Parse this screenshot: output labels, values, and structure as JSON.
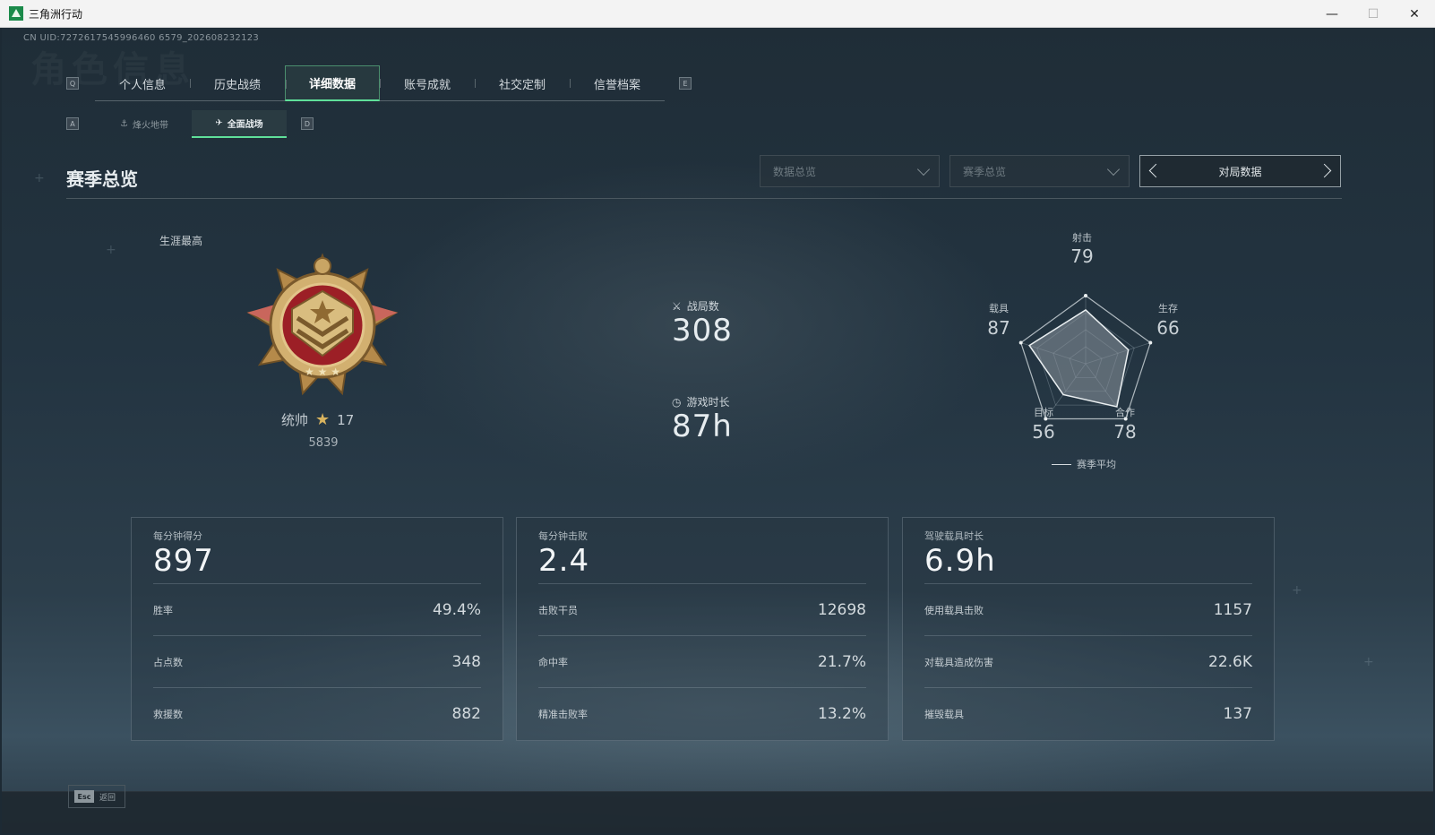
{
  "window": {
    "title": "三角洲行动",
    "minimize": "—",
    "maximize": "☐",
    "close": "✕"
  },
  "uid": "CN UID:7272617545996460 6579_202608232123",
  "ghost_title": "角色信息",
  "tab_keys": {
    "left": "Q",
    "right": "E"
  },
  "tabs": [
    {
      "label": "个人信息",
      "active": false
    },
    {
      "label": "历史战绩",
      "active": false
    },
    {
      "label": "详细数据",
      "active": true
    },
    {
      "label": "账号成就",
      "active": false
    },
    {
      "label": "社交定制",
      "active": false
    },
    {
      "label": "信誉档案",
      "active": false
    }
  ],
  "subtab_keys": {
    "left": "A",
    "right": "D"
  },
  "subtabs": [
    {
      "label": "烽火地带",
      "icon": "hazard-zone-icon",
      "active": false
    },
    {
      "label": "全面战场",
      "icon": "battlefield-icon",
      "active": true
    }
  ],
  "section_title": "赛季总览",
  "dropdowns": [
    {
      "value": "数据总览"
    },
    {
      "value": "赛季总览"
    }
  ],
  "match_nav": {
    "label": "对局数据"
  },
  "career": {
    "label": "生涯最高",
    "rank_name": "统帅",
    "rank_stars": "17",
    "score": "5839"
  },
  "summary": {
    "matches_label": "战局数",
    "matches_value": "308",
    "playtime_label": "游戏时长",
    "playtime_value": "87h"
  },
  "radar": {
    "axes": [
      {
        "label": "射击",
        "value": 79
      },
      {
        "label": "生存",
        "value": 66
      },
      {
        "label": "合作",
        "value": 78
      },
      {
        "label": "目标",
        "value": 56
      },
      {
        "label": "载具",
        "value": 87
      }
    ],
    "legend": "赛季平均"
  },
  "cards": [
    {
      "title": "每分钟得分",
      "value": "897",
      "rows": [
        {
          "label": "胜率",
          "value": "49.4%"
        },
        {
          "label": "占点数",
          "value": "348"
        },
        {
          "label": "救援数",
          "value": "882"
        }
      ]
    },
    {
      "title": "每分钟击败",
      "value": "2.4",
      "rows": [
        {
          "label": "击败干员",
          "value": "12698"
        },
        {
          "label": "命中率",
          "value": "21.7%"
        },
        {
          "label": "精准击败率",
          "value": "13.2%"
        }
      ]
    },
    {
      "title": "驾驶载具时长",
      "value": "6.9h",
      "rows": [
        {
          "label": "使用载具击败",
          "value": "1157"
        },
        {
          "label": "对载具造成伤害",
          "value": "22.6K"
        },
        {
          "label": "摧毁载具",
          "value": "137"
        }
      ]
    }
  ],
  "footer": {
    "esc_key": "Esc",
    "back_label": "返回"
  },
  "colors": {
    "accent": "#5fe09a",
    "medal_gold": "#d8b35e",
    "medal_red": "#a8232b"
  }
}
